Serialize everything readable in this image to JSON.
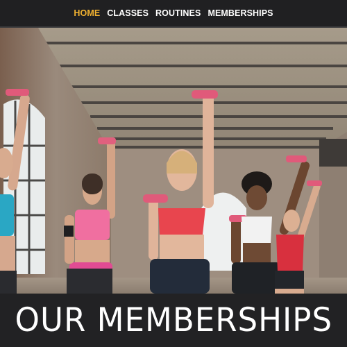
{
  "nav": {
    "items": [
      {
        "label": "HOME",
        "active": true
      },
      {
        "label": "CLASSES",
        "active": false
      },
      {
        "label": "ROUTINES",
        "active": false
      },
      {
        "label": "MEMBERSHIPS",
        "active": false
      }
    ],
    "active_color": "#f2b230",
    "text_color": "#ffffff"
  },
  "hero": {
    "image": "fitness-class-with-dumbbells-photo"
  },
  "banner": {
    "title": "OUR MEMBERSHIPS"
  }
}
